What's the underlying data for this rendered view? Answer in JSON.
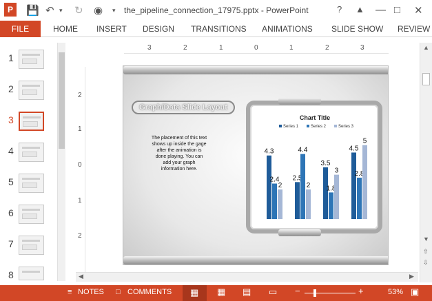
{
  "window": {
    "title": "the_pipeline_connection_17975.pptx - PowerPoint",
    "app_icon": "P",
    "help": "?",
    "controls": [
      "restore-icon",
      "minimize-icon",
      "maximize-icon",
      "close-icon"
    ]
  },
  "ribbon": {
    "file": "FILE",
    "tabs": [
      "HOME",
      "INSERT",
      "DESIGN",
      "TRANSITIONS",
      "ANIMATIONS",
      "SLIDE SHOW",
      "REVIEW"
    ]
  },
  "thumbnails": {
    "numbers": [
      "1",
      "2",
      "3",
      "4",
      "5",
      "6",
      "7",
      "8"
    ],
    "selected": "3"
  },
  "ruler": {
    "horizontal": [
      "3",
      "2",
      "1",
      "0",
      "1",
      "2",
      "3"
    ],
    "vertical": [
      "2",
      "1",
      "0",
      "1",
      "2"
    ]
  },
  "slide": {
    "title_pill": "Graph/Data Slide Layout",
    "body_text": "The placement of this text shows up inside the gage after the animation is done playing.  You can add your graph information here."
  },
  "chart_data": {
    "type": "bar",
    "title": "Chart Title",
    "categories": [
      "",
      "",
      "",
      ""
    ],
    "series": [
      {
        "name": "Series 1",
        "values": [
          4.3,
          2.5,
          3.5,
          4.5
        ],
        "color": "#1f5c99"
      },
      {
        "name": "Series 2",
        "values": [
          2.4,
          4.4,
          1.8,
          2.8
        ],
        "color": "#2e75b6"
      },
      {
        "name": "Series 3",
        "values": [
          2,
          2,
          3,
          5
        ],
        "color": "#a5b7d6"
      }
    ],
    "ylim": [
      0,
      5.5
    ],
    "legend": "top",
    "grid": false
  },
  "status": {
    "notes": "NOTES",
    "comments": "COMMENTS",
    "zoom": "53%"
  }
}
